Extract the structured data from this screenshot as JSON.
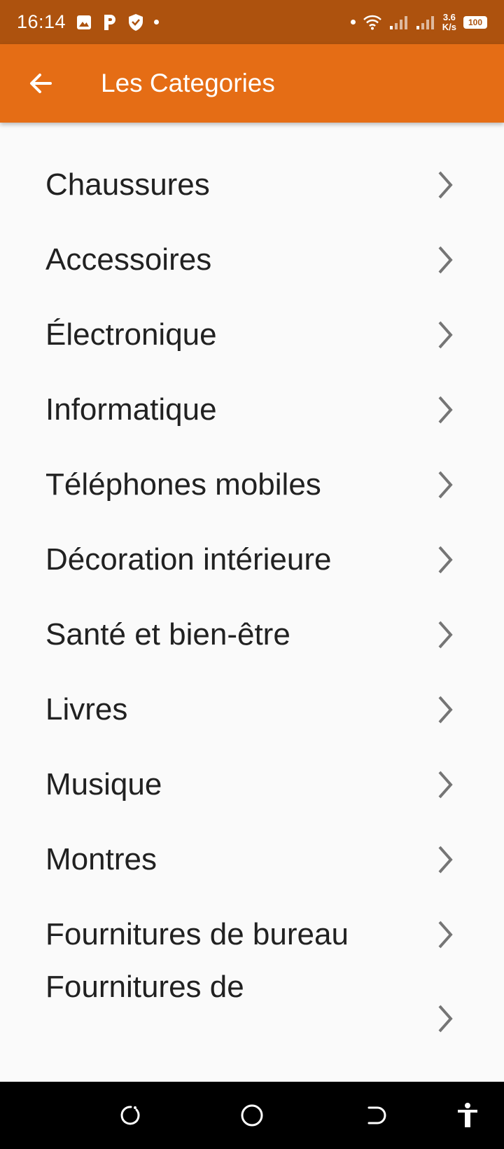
{
  "status_bar": {
    "time": "16:14",
    "speed_value": "3.6",
    "speed_unit": "K/s",
    "battery": "100",
    "icons": [
      "image-icon",
      "p-icon",
      "shield-icon",
      "dot-icon",
      "wifi-icon",
      "signal-icon",
      "signal-icon",
      "battery-icon"
    ]
  },
  "app_bar": {
    "title": "Les Categories",
    "back_icon": "arrow-left-icon"
  },
  "categories": [
    "Chaussures",
    "Accessoires",
    "Électronique",
    "Informatique",
    "Téléphones mobiles",
    "Décoration intérieure",
    "Santé et bien-être",
    "Livres",
    "Musique",
    "Montres",
    "Fournitures de bureau",
    "Fournitures de"
  ],
  "nav_bar": {
    "icons": [
      "recent-apps-icon",
      "home-icon",
      "back-icon",
      "accessibility-icon"
    ]
  },
  "colors": {
    "status_bar": "#ad520e",
    "app_bar": "#e56d15",
    "background": "#fafafa",
    "text": "#212121",
    "chevron": "#757575"
  }
}
